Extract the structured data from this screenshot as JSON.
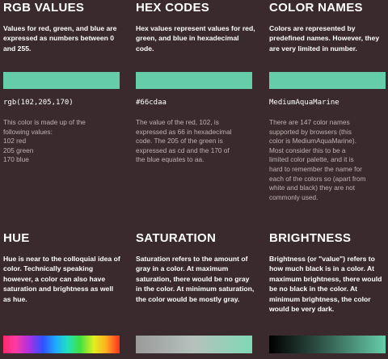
{
  "sections": {
    "rgb": {
      "title": "RGB VALUES",
      "intro": "Values for red, green, and blue are expressed as numbers between 0 and 255.",
      "code": "rgb(102,205,170)",
      "detail_lines": [
        "This color is made up of the",
        "following values:",
        "102 red",
        "205 green",
        "170 blue"
      ]
    },
    "hex": {
      "title": "HEX CODES",
      "intro": "Hex values represent values for red, green, and blue in hexadecimal code.",
      "code": "#66cdaa",
      "detail_lines": [
        "The value of the red, 102, is",
        "expressed as 66 in hexadecimal",
        "code. The 205 of the green is",
        "expressed as cd and the 170 of",
        "the blue equates to aa."
      ]
    },
    "names": {
      "title": "COLOR NAMES",
      "intro": "Colors are represented by predefined names. However, they are very limited in number.",
      "code": "MediumAquaMarine",
      "detail_lines": [
        "There are 147 color names",
        "supported by browsers (this",
        "color is MediumAquaMarine).",
        "Most consider this to be a",
        "limited color palette, and it is",
        "hard to remember the name for",
        "each of the colors so (apart from",
        "white and black) they are not",
        "commonly used."
      ]
    },
    "hue": {
      "title": "HUE",
      "intro": "Hue is near to the colloquial idea of color. Technically speaking however, a color can also have saturation and brightness as well as hue."
    },
    "saturation": {
      "title": "SATURATION",
      "intro": "Saturation refers to the amount of gray in a color. At maximum saturation, there would be no gray in the color. At minimum saturation, the color would be mostly gray."
    },
    "brightness": {
      "title": "BRIGHTNESS",
      "intro": "Brightness (or \"value\") refers to how much black is in a color. At maximum brightness, there would be no black in the color. At minimum brightness, the color would be very dark."
    }
  },
  "colors": {
    "background": "#3b2a2d",
    "swatch": "#66cdaa",
    "muted_text": "#bdb2b3"
  }
}
